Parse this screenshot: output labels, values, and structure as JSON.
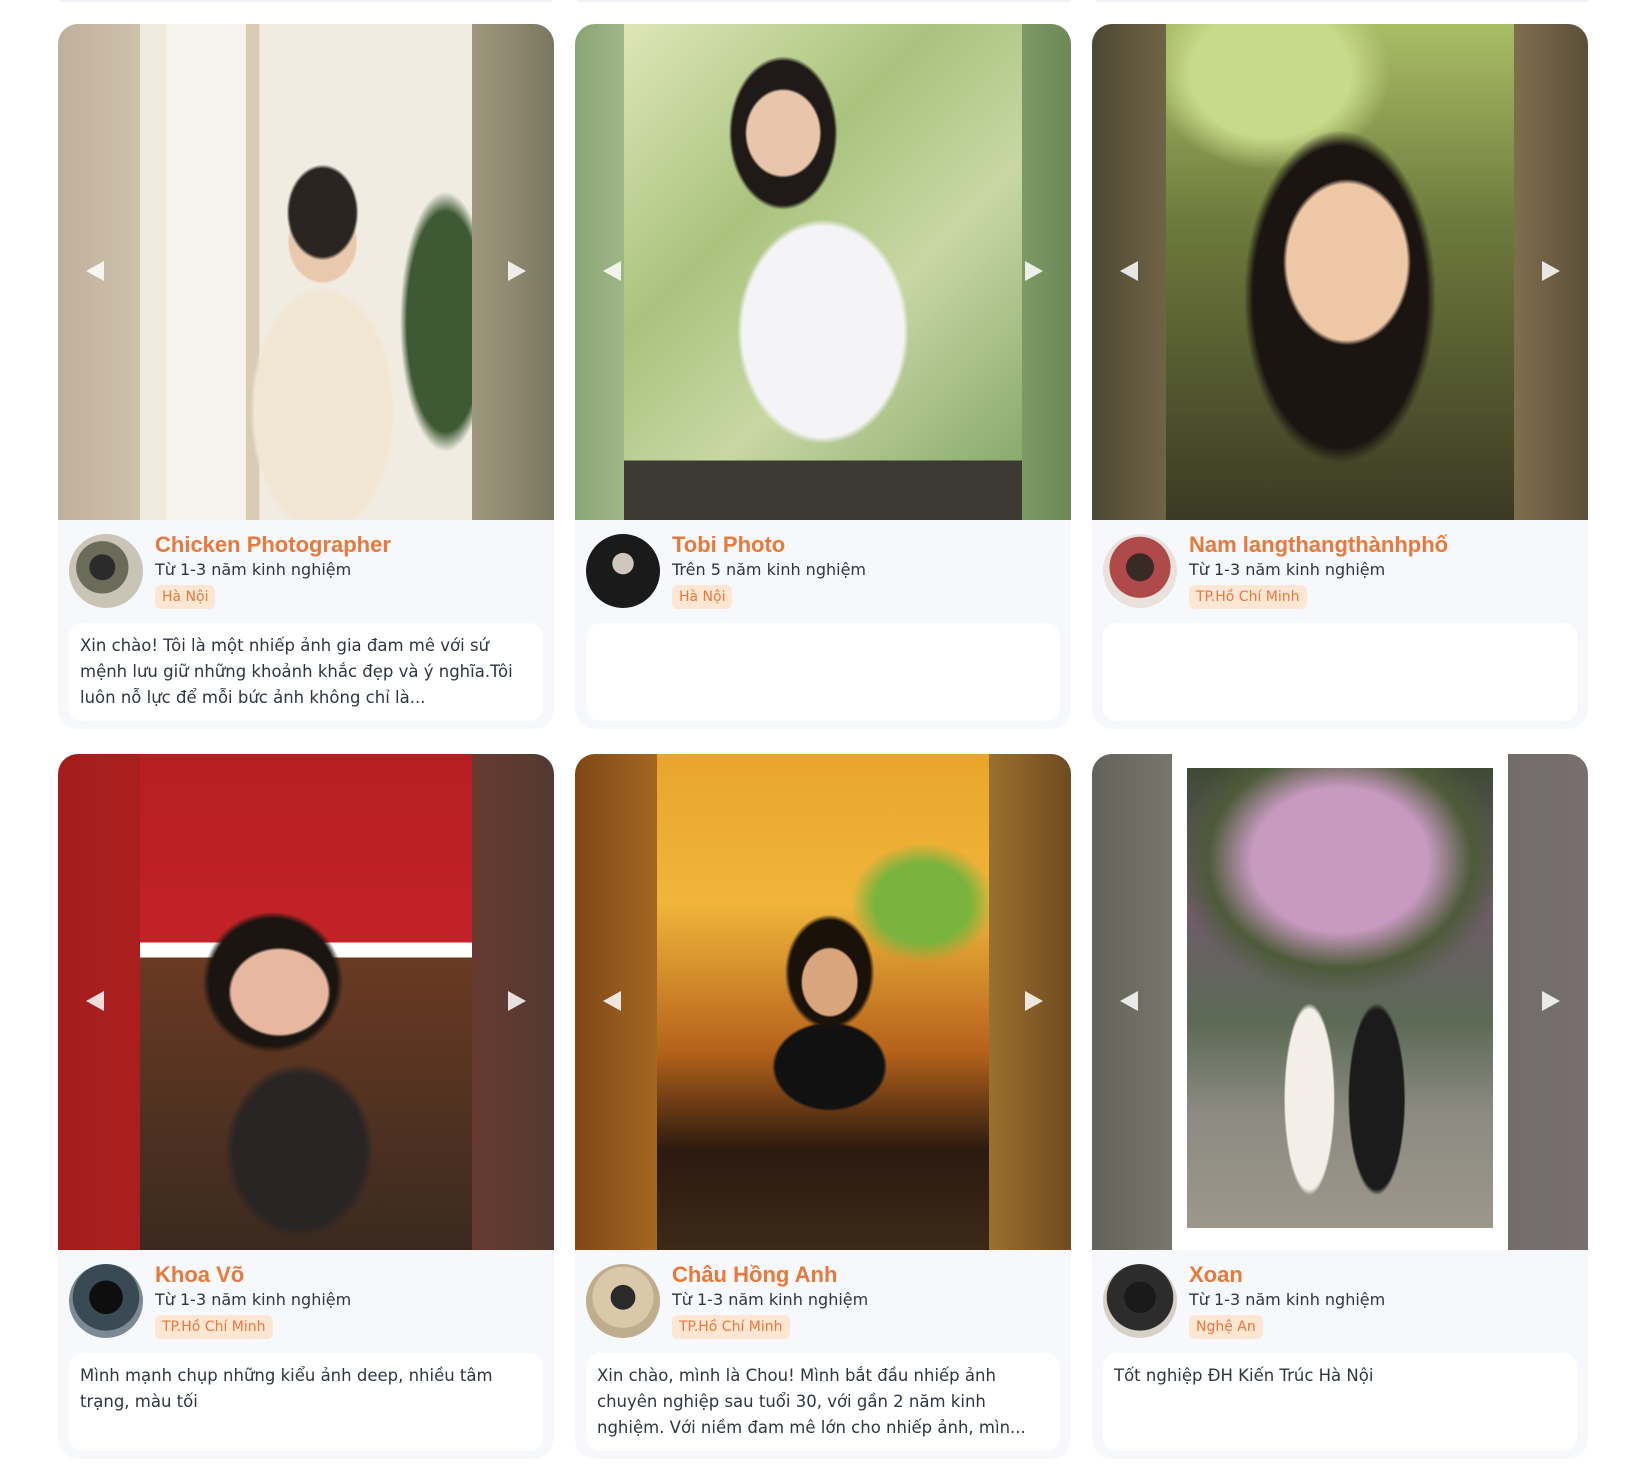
{
  "cards": [
    {
      "name": "Chicken Photographer",
      "experience": "Từ 1-3 năm kinh nghiệm",
      "location": "Hà Nội",
      "bio": "Xin chào! Tôi là một nhiếp ảnh gia đam mê với sứ mệnh lưu giữ những khoảnh khắc đẹp và ý nghĩa.Tôi luôn nỗ lực để mỗi bức ảnh không chỉ là..."
    },
    {
      "name": "Tobi Photo",
      "experience": "Trên 5 năm kinh nghiệm",
      "location": "Hà Nội",
      "bio": ""
    },
    {
      "name": "Nam langthangthànhphố",
      "experience": "Từ 1-3 năm kinh nghiệm",
      "location": "TP.Hồ Chí Minh",
      "bio": ""
    },
    {
      "name": "Khoa Võ",
      "experience": "Từ 1-3 năm kinh nghiệm",
      "location": "TP.Hồ Chí Minh",
      "bio": "Mình mạnh chụp những kiểu ảnh deep, nhiều tâm trạng, màu tối"
    },
    {
      "name": "Châu Hồng Anh",
      "experience": "Từ 1-3 năm kinh nghiệm",
      "location": "TP.Hồ Chí Minh",
      "bio": "Xin chào, mình là Chou! Mình bắt đầu nhiếp ảnh chuyên nghiệp sau tuổi 30, với gần 2 năm kinh nghiệm. Với niềm đam mê lớn cho nhiếp ảnh, mìn..."
    },
    {
      "name": "Xoan",
      "experience": "Từ 1-3 năm kinh nghiệm",
      "location": "Nghệ An",
      "bio": "Tốt nghiệp ĐH Kiến Trúc Hà Nội"
    }
  ],
  "icons": {
    "prev": "chevron-left-icon",
    "next": "chevron-right-icon"
  },
  "colors": {
    "name": "#e8793a",
    "badge_bg": "#fde6d4",
    "card_bg": "#f6f8fb",
    "text": "#2f3640"
  }
}
